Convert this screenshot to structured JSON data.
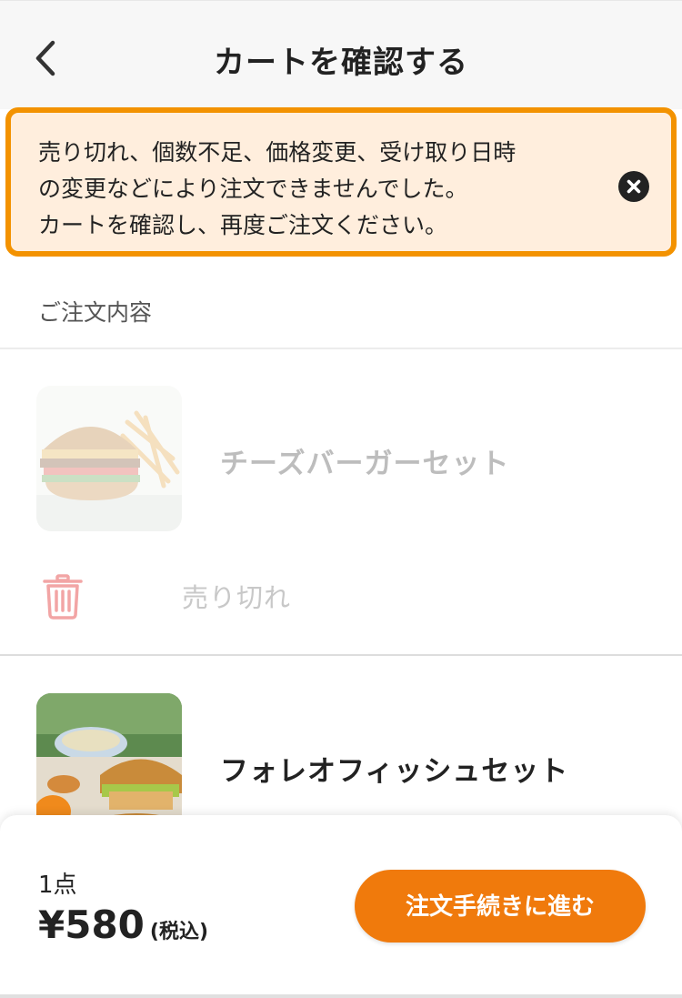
{
  "header": {
    "title": "カートを確認する",
    "back_icon": "chevron-left-icon"
  },
  "alert": {
    "lines": [
      "売り切れ、個数不足、価格変更、受け取り日時",
      "の変更などにより注文できませんでした。",
      "カートを確認し、再度ご注文ください。"
    ],
    "close_icon": "close-icon",
    "border_color": "#f39200",
    "background_color": "#ffeedd"
  },
  "order": {
    "section_label": "ご注文内容",
    "items": [
      {
        "name": "チーズバーガーセット",
        "status": "売り切れ",
        "available": false,
        "image": "cheeseburger-set-photo",
        "delete_icon": "trash-icon"
      },
      {
        "name": "フォレオフィッシュセット",
        "available": true,
        "image": "fish-burger-set-photo"
      }
    ]
  },
  "footer": {
    "count": "1点",
    "price": "¥580",
    "tax_note": "(税込)",
    "order_button": "注文手続きに進む",
    "accent_color": "#f07a0c"
  }
}
